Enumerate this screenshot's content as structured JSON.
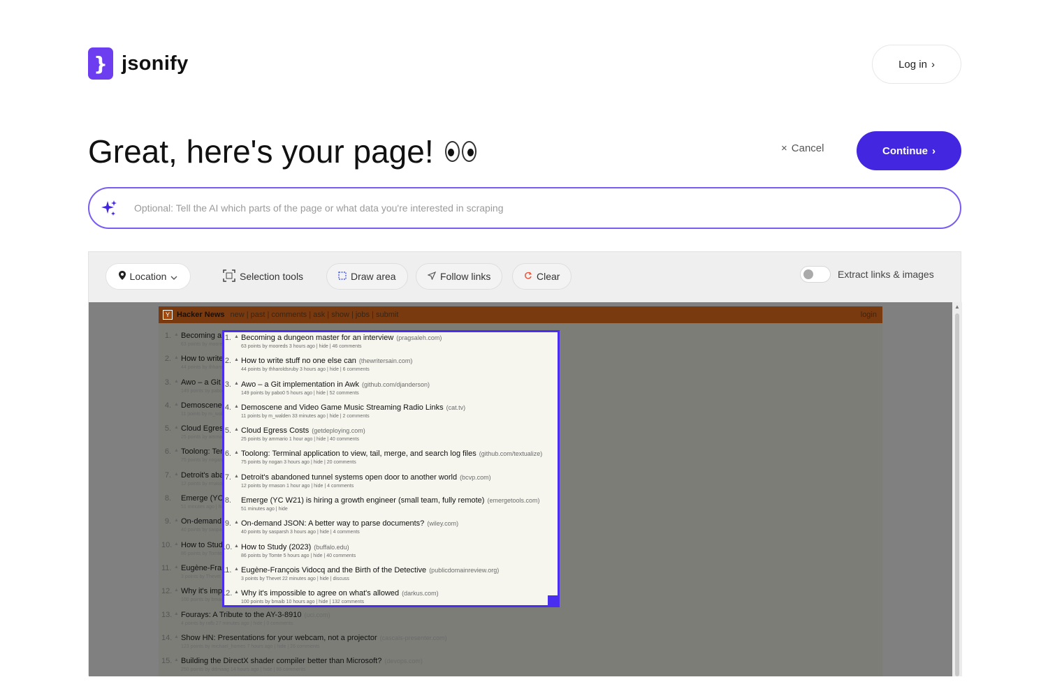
{
  "brand": {
    "name": "jsonify",
    "mark": "}"
  },
  "header": {
    "login_label": "Log in",
    "login_chevron": "›"
  },
  "title": {
    "text": "Great, here's your page!",
    "emoji": "eyes"
  },
  "actions": {
    "cancel_label": "Cancel",
    "cancel_icon": "×",
    "continue_label": "Continue",
    "continue_chevron": "›"
  },
  "ai_prompt": {
    "placeholder": "Optional: Tell the AI which parts of the page or what data you're interested in scraping",
    "value": "",
    "icon": "sparkles-icon"
  },
  "toolbar": {
    "location_label": "Location",
    "selection_tools_label": "Selection tools",
    "draw_area_label": "Draw area",
    "follow_links_label": "Follow links",
    "clear_label": "Clear",
    "extract_label": "Extract links & images",
    "extract_enabled": false
  },
  "hn": {
    "site_name": "Hacker News",
    "nav": "new | past | comments | ask | show | jobs | submit",
    "login": "login",
    "items": [
      {
        "rank": "1.",
        "title": "Becoming a dungeon master for an interview",
        "site": "(pragsaleh.com)",
        "sub": "63 points by mooreds 3 hours ago | hide | 46 comments"
      },
      {
        "rank": "2.",
        "title": "How to write stuff no one else can",
        "site": "(thewritersain.com)",
        "sub": "44 points by thharoldsruby 3 hours ago | hide | 6 comments"
      },
      {
        "rank": "3.",
        "title": "Awo – a Git implementation in Awk",
        "site": "(github.com/djanderson)",
        "sub": "149 points by pabo0 5 hours ago | hide | 52 comments"
      },
      {
        "rank": "4.",
        "title": "Demoscene and Video Game Music Streaming Radio Links",
        "site": "(cat.tv)",
        "sub": "11 points by m_walden 33 minutes ago | hide | 2 comments"
      },
      {
        "rank": "5.",
        "title": "Cloud Egress Costs",
        "site": "(getdeploying.com)",
        "sub": "25 points by ammario 1 hour ago | hide | 40 comments"
      },
      {
        "rank": "6.",
        "title": "Toolong: Terminal application to view, tail, merge, and search log files",
        "site": "(github.com/textualize)",
        "sub": "75 points by nogan 3 hours ago | hide | 20 comments"
      },
      {
        "rank": "7.",
        "title": "Detroit's abandoned tunnel systems open door to another world",
        "site": "(bcvp.com)",
        "sub": "12 points by rmason 1 hour ago | hide | 4 comments"
      },
      {
        "rank": "8.",
        "title": "Emerge (YC W21) is hiring a growth engineer (small team, fully remote)",
        "site": "(emergetools.com)",
        "sub": "51 minutes ago | hide"
      },
      {
        "rank": "9.",
        "title": "On-demand JSON: A better way to parse documents?",
        "site": "(wiley.com)",
        "sub": "40 points by sasparsh 3 hours ago | hide | 4 comments"
      },
      {
        "rank": "10.",
        "title": "How to Study (2023)",
        "site": "(buffalo.edu)",
        "sub": "86 points by Tomte 5 hours ago | hide | 40 comments"
      },
      {
        "rank": "11.",
        "title": "Eugène-François Vidocq and the Birth of the Detective",
        "site": "(publicdomainreview.org)",
        "sub": "3 points by Thevet 22 minutes ago | hide | discuss"
      },
      {
        "rank": "12.",
        "title": "Why it's impossible to agree on what's allowed",
        "site": "(darkus.com)",
        "sub": "100 points by bmaib 10 hours ago | hide | 132 comments"
      },
      {
        "rank": "13.",
        "title": "Fourays: A Tribute to the AY-3-8910",
        "site": "(uci.com)",
        "sub": "4 points by rafb 27 minutes ago | hide | 0 comments"
      },
      {
        "rank": "14.",
        "title": "Show HN: Presentations for your webcam, not a projector",
        "site": "(cascals-presenter.com)",
        "sub": "123 points by michael_homes 7 hours ago | hide | 26 comments"
      },
      {
        "rank": "15.",
        "title": "Building the DirectX shader compiler better than Microsoft?",
        "site": "(devops.com)",
        "sub": "250 points by ddmaag 14 hours ago | hide | 86 comments"
      }
    ]
  },
  "colors": {
    "accent": "#4226e0",
    "brand": "#6d3ef0",
    "selection": "#4a2ef0",
    "hn_bar": "#7a3a10"
  }
}
